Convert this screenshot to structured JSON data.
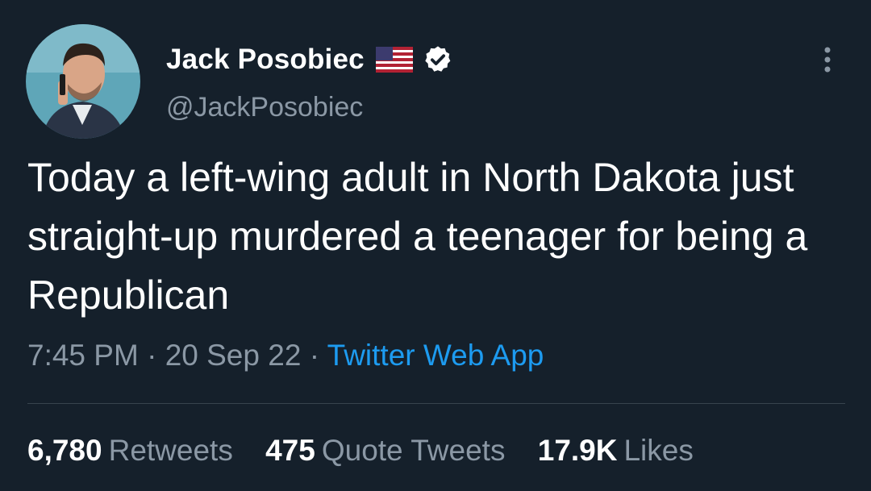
{
  "author": {
    "display_name": "Jack Posobiec",
    "handle": "@JackPosobiec",
    "flag_icon": "us-flag-icon",
    "verified_icon": "verified-badge-icon"
  },
  "tweet": {
    "text": "Today a left-wing adult in North Dakota just straight-up murdered a teenager for being a Republican",
    "time": "7:45 PM",
    "date": "20 Sep 22",
    "separator": "·",
    "source": "Twitter Web App"
  },
  "stats": [
    {
      "count": "6,780",
      "label": "Retweets"
    },
    {
      "count": "475",
      "label": "Quote Tweets"
    },
    {
      "count": "17.9K",
      "label": "Likes"
    }
  ],
  "colors": {
    "background": "#15202b",
    "text": "#ffffff",
    "secondary": "#8b98a5",
    "link": "#1d9bf0",
    "divider": "#38444d"
  }
}
